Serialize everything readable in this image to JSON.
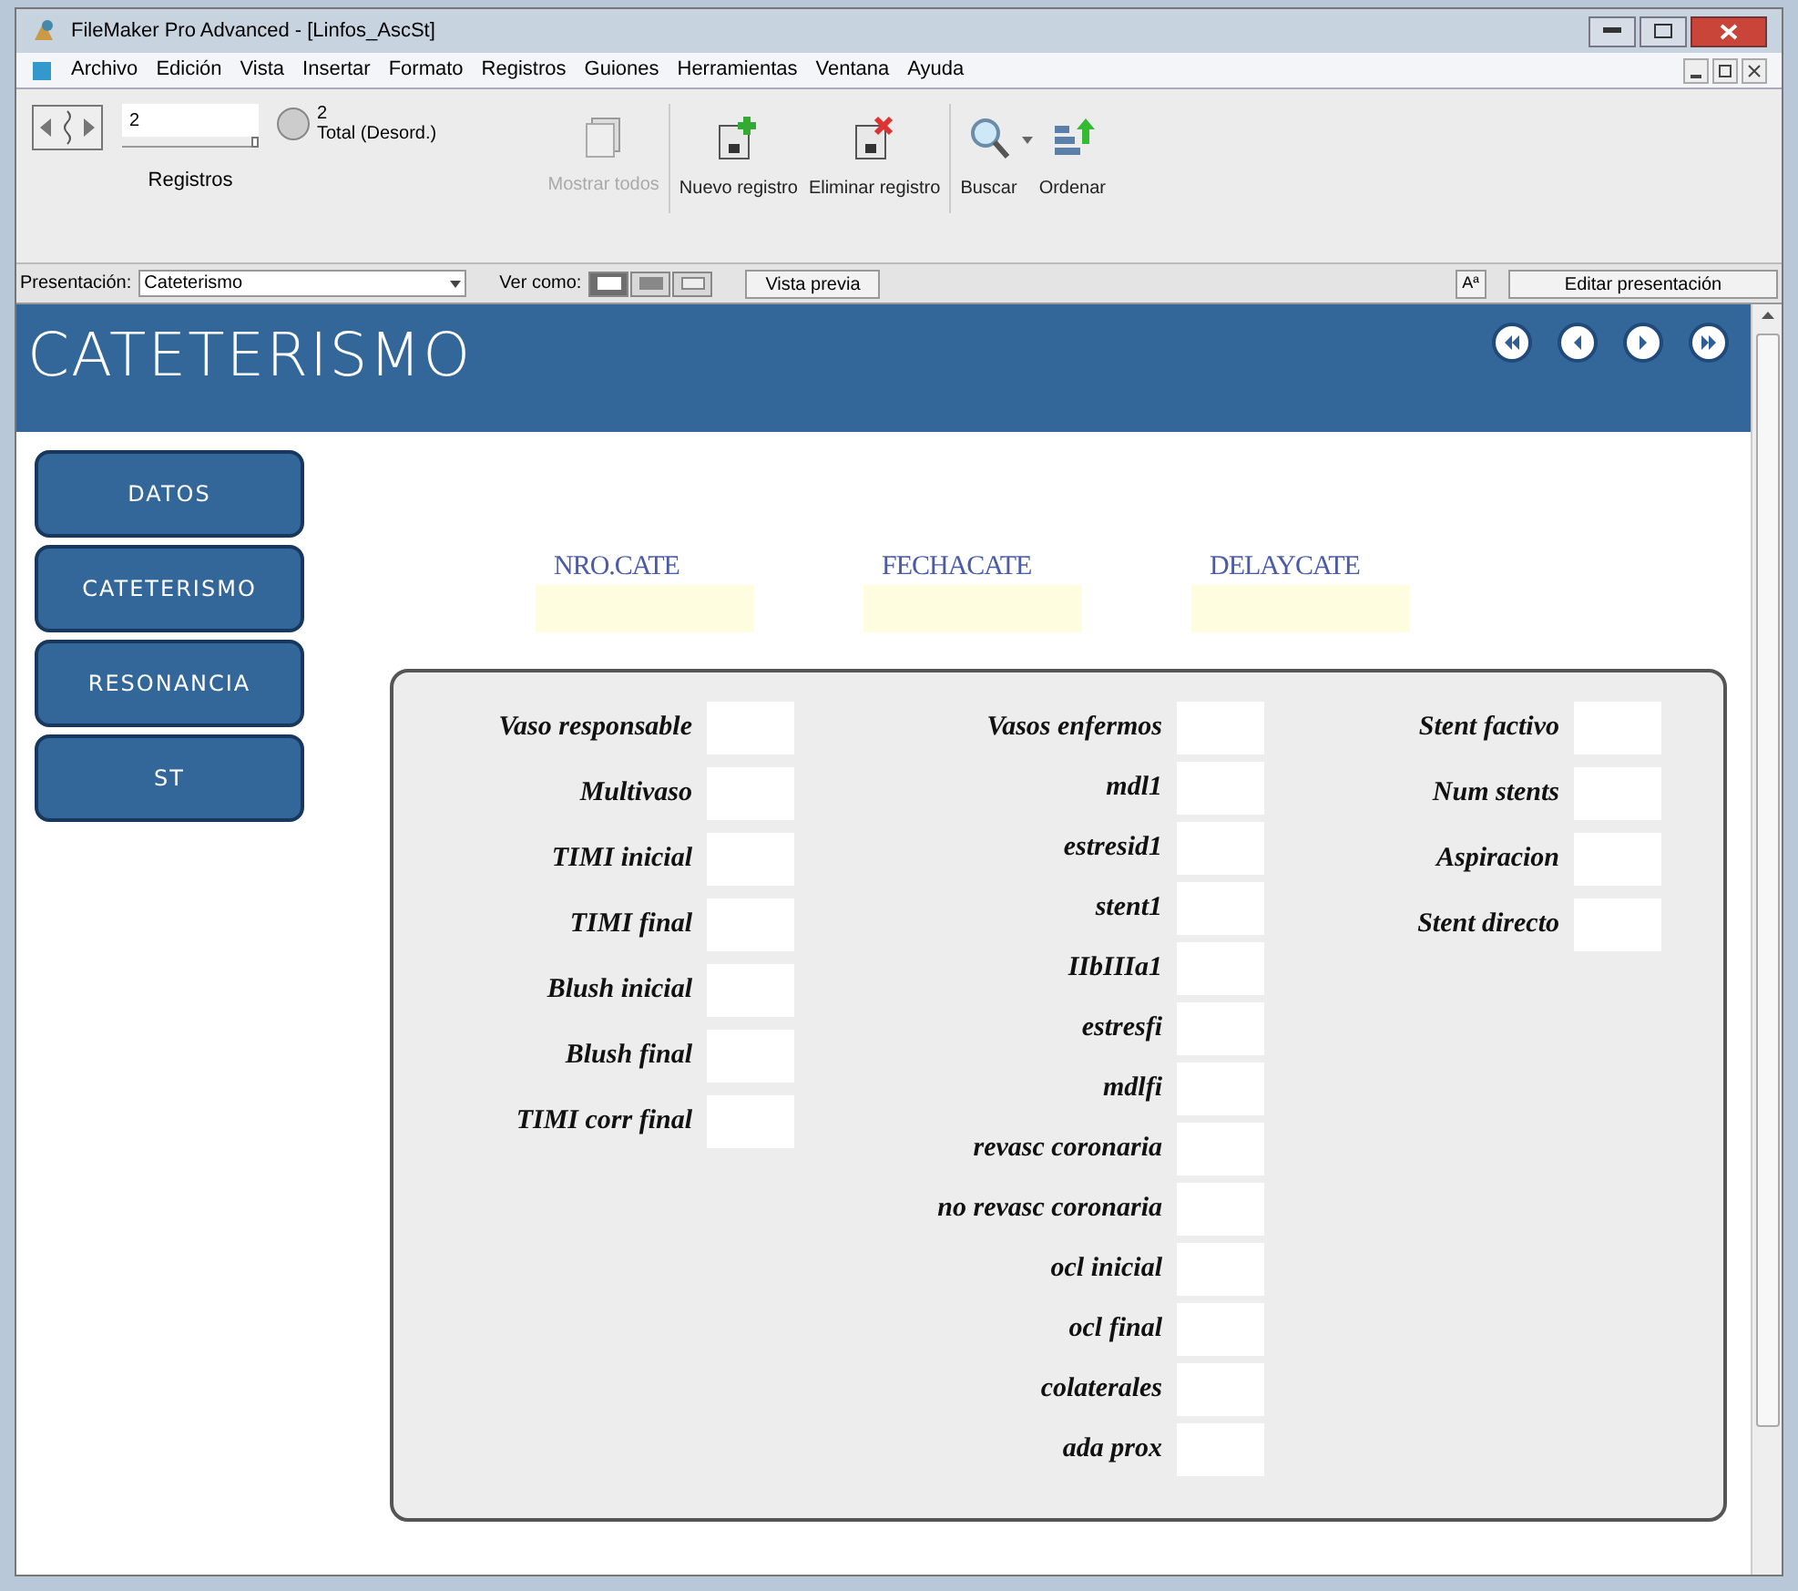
{
  "window": {
    "title": "FileMaker Pro Advanced - [Linfos_AscSt]"
  },
  "menu": [
    "Archivo",
    "Edición",
    "Vista",
    "Insertar",
    "Formato",
    "Registros",
    "Guiones",
    "Herramientas",
    "Ventana",
    "Ayuda"
  ],
  "records": {
    "current": "2",
    "level": 1,
    "label": "Registros",
    "found": "2",
    "total": "Total (Desord.)"
  },
  "toolbar": [
    {
      "label": "Mostrar todos",
      "kind": "showall",
      "disabled": true
    },
    {
      "label": "Nuevo registro",
      "kind": "new",
      "disabled": false
    },
    {
      "label": "Eliminar registro",
      "kind": "delete",
      "disabled": false
    },
    {
      "label": "Buscar",
      "kind": "find",
      "disabled": false
    },
    {
      "label": "Ordenar",
      "kind": "sort",
      "disabled": false
    }
  ],
  "layout_bar": {
    "label": "Presentación:",
    "layout": "Cateterismo",
    "view_label": "Ver como:",
    "view_modes": [
      {
        "kind": "form",
        "selected": true
      },
      {
        "kind": "list",
        "selected": false
      },
      {
        "kind": "table",
        "selected": false
      }
    ],
    "preview": "Vista previa",
    "format_icon": "Aª",
    "edit": "Editar presentación"
  },
  "header": {
    "title": "CATETERISMO"
  },
  "nav": [
    "DATOS",
    "CATETERISMO",
    "RESONANCIA",
    "ST"
  ],
  "top_fields": [
    "NRO.CATE",
    "FECHACATE",
    "DELAYCATE"
  ],
  "columns": [
    [
      "Vaso responsable",
      "Multivaso",
      "TIMI inicial",
      "TIMI final",
      "Blush inicial",
      "Blush final",
      "TIMI corr final"
    ],
    [
      "Vasos enfermos",
      "mdl1",
      "estresid1",
      "stent1",
      "IIbIIIa1",
      "estresfi",
      "mdlfi",
      "revasc coronaria",
      "no revasc coronaria",
      "ocl inicial",
      "ocl final",
      "colaterales",
      "ada prox"
    ],
    [
      "Stent factivo",
      "Num stents",
      "Aspiracion",
      "Stent directo"
    ]
  ]
}
